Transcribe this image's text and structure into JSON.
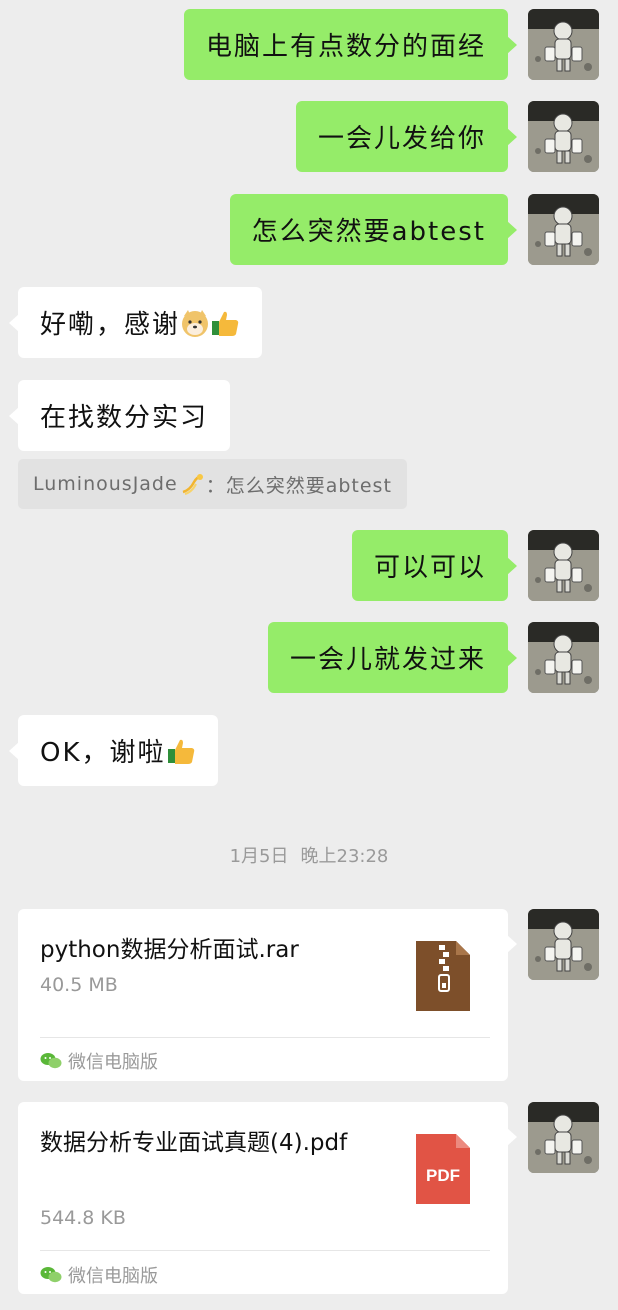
{
  "messages": [
    {
      "text": "电脑上有点数分的面经"
    },
    {
      "text": "一会儿发给你"
    },
    {
      "text": "怎么突然要abtest"
    },
    {
      "text": "好嘞，感谢"
    },
    {
      "text": "在找数分实习"
    },
    {
      "quote": "LuminousJade",
      "quote_sep": "：",
      "quote_text": "怎么突然要abtest"
    },
    {
      "text": "可以可以"
    },
    {
      "text": "一会儿就发过来"
    },
    {
      "text": "OK，谢啦"
    }
  ],
  "timestamp": {
    "date": "1月5日",
    "time": "晚上23:28"
  },
  "files": [
    {
      "name": "python数据分析面试.rar",
      "size": "40.5 MB",
      "source": "微信电脑版",
      "icon": "zip-archive-icon",
      "icon_color": "#7d4f2a"
    },
    {
      "name": "数据分析专业面试真题(4).pdf",
      "size": "544.8 KB",
      "source": "微信电脑版",
      "icon": "pdf-icon",
      "icon_color": "#e15445",
      "icon_label": "PDF"
    }
  ],
  "colors": {
    "my_bubble": "#95ec69",
    "their_bubble": "#ffffff",
    "background": "#ededed"
  }
}
